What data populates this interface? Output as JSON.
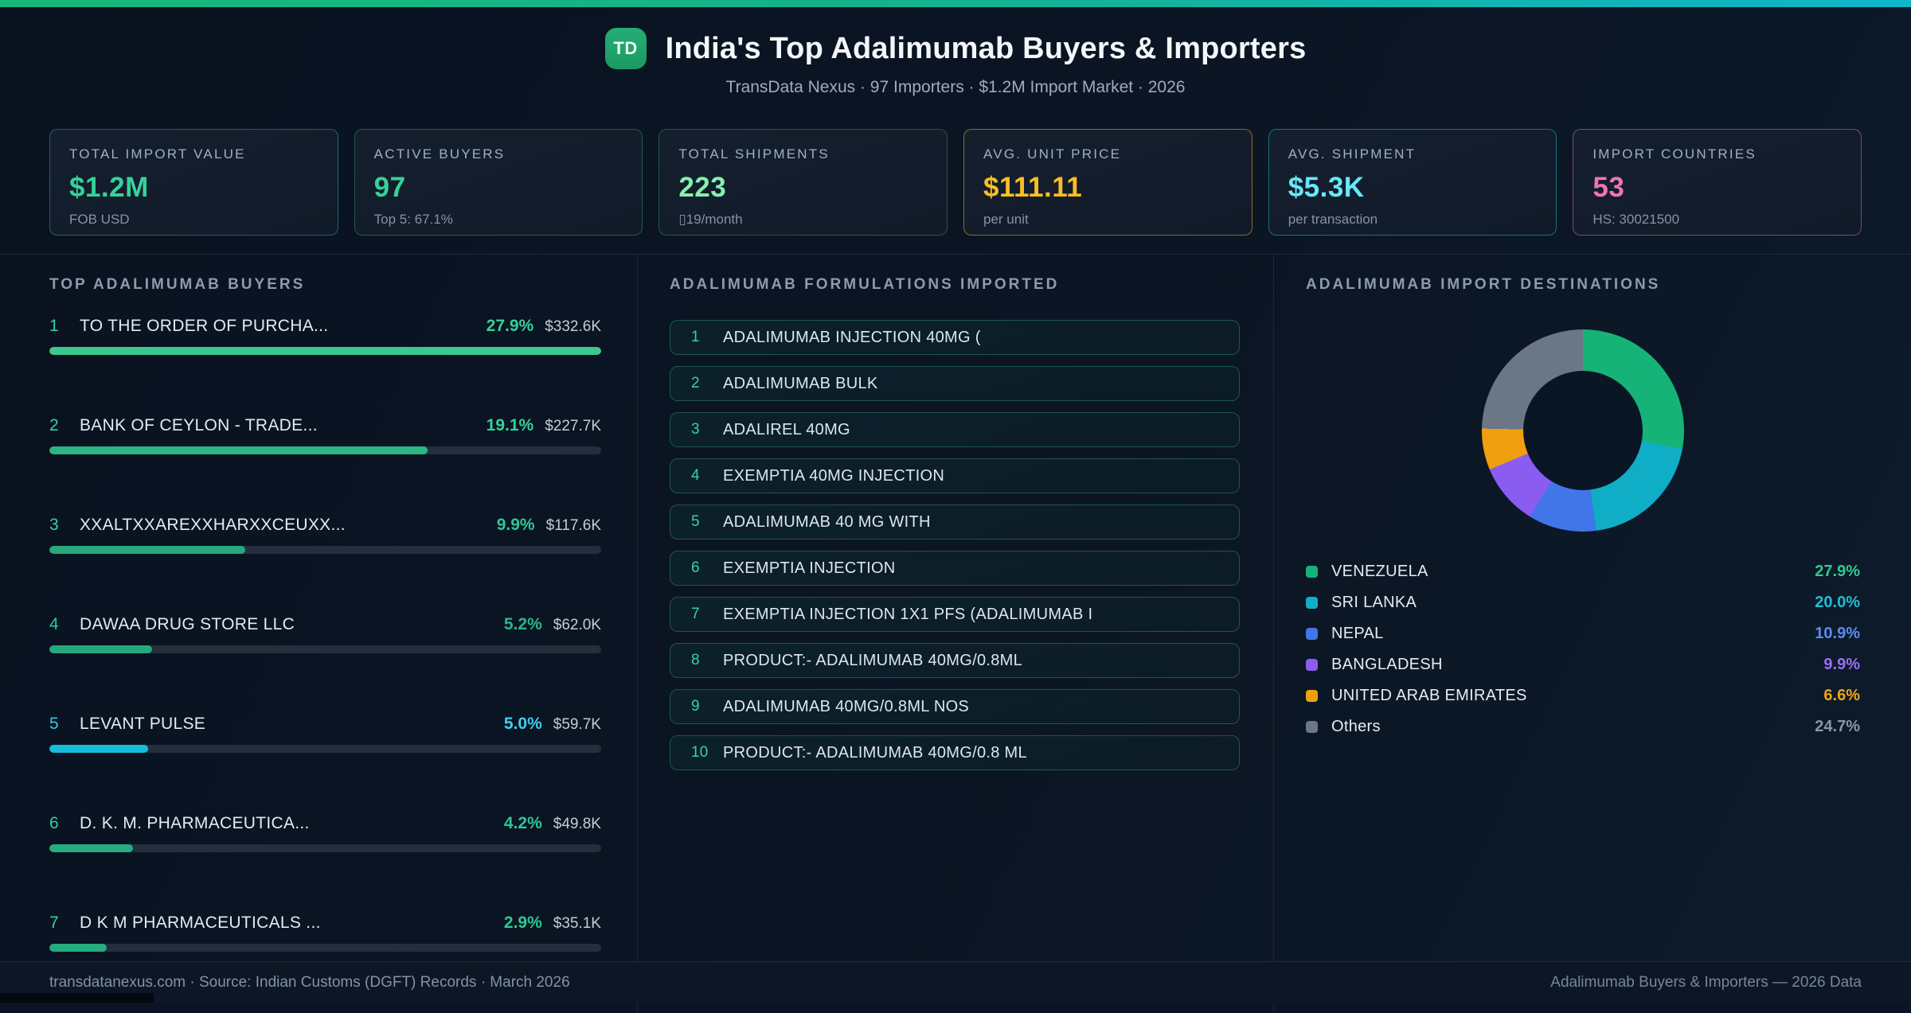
{
  "header": {
    "logo": "TD",
    "title": "India's Top Adalimumab Buyers & Importers",
    "subtitle": "TransData Nexus · 97 Importers · $1.2M Import Market · 2026"
  },
  "stats": [
    {
      "label": "TOTAL IMPORT VALUE",
      "value": "$1.2M",
      "sub": "FOB USD",
      "value_color": "#34d399",
      "border_color": "rgba(45,212,191,0.40)"
    },
    {
      "label": "ACTIVE BUYERS",
      "value": "97",
      "sub": "Top 5: 67.1%",
      "value_color": "#34d399",
      "border_color": "rgba(52,211,153,0.35)"
    },
    {
      "label": "TOTAL SHIPMENTS",
      "value": "223",
      "sub": "▯19/month",
      "value_color": "#86efac",
      "border_color": "rgba(74,222,128,0.30)"
    },
    {
      "label": "AVG. UNIT PRICE",
      "value": "$111.11",
      "sub": "per unit",
      "value_color": "#fbbf24",
      "border_color": "rgba(251,191,36,0.50)"
    },
    {
      "label": "AVG. SHIPMENT",
      "value": "$5.3K",
      "sub": "per transaction",
      "value_color": "#67e8f9",
      "border_color": "rgba(34,211,238,0.45)"
    },
    {
      "label": "IMPORT COUNTRIES",
      "value": "53",
      "sub": "HS: 30021500",
      "value_color": "#f472b6",
      "border_color": "rgba(244,114,182,0.50)"
    }
  ],
  "buyers": {
    "title": "TOP ADALIMUMAB BUYERS",
    "items": [
      {
        "rank": "1",
        "name": "TO THE ORDER OF PURCHA...",
        "pct": 27.9,
        "pct_label": "27.9%",
        "value": "$332.6K",
        "accent": "#3dc98d",
        "pct_color": "#34d399",
        "rank_color": "#2dd49f"
      },
      {
        "rank": "2",
        "name": "BANK OF CEYLON - TRADE...",
        "pct": 19.1,
        "pct_label": "19.1%",
        "value": "$227.7K",
        "accent": "#2bb583",
        "pct_color": "#34d399",
        "rank_color": "#2dd49f"
      },
      {
        "rank": "3",
        "name": "XXALTXXAREXXHARXXCEUXX...",
        "pct": 9.9,
        "pct_label": "9.9%",
        "value": "$117.6K",
        "accent": "#27a97c",
        "pct_color": "#2fc796",
        "rank_color": "#2dd49f"
      },
      {
        "rank": "4",
        "name": "DAWAA DRUG STORE LLC",
        "pct": 5.2,
        "pct_label": "5.2%",
        "value": "$62.0K",
        "accent": "#26a87d",
        "pct_color": "#2bb58a",
        "rank_color": "#2ac89a"
      },
      {
        "rank": "5",
        "name": "LEVANT PULSE",
        "pct": 5.0,
        "pct_label": "5.0%",
        "value": "$59.7K",
        "accent": "#17bdd8",
        "pct_color": "#41cdf0",
        "rank_color": "#36c5e6"
      },
      {
        "rank": "6",
        "name": "D. K. M. PHARMACEUTICA...",
        "pct": 4.2,
        "pct_label": "4.2%",
        "value": "$49.8K",
        "accent": "#25ad80",
        "pct_color": "#2fc796",
        "rank_color": "#2dd49f"
      },
      {
        "rank": "7",
        "name": "D K M PHARMACEUTICALS ...",
        "pct": 2.9,
        "pct_label": "2.9%",
        "value": "$35.1K",
        "accent": "#25ad80",
        "pct_color": "#2fc796",
        "rank_color": "#2dd49f"
      }
    ]
  },
  "formulations": {
    "title": "ADALIMUMAB FORMULATIONS IMPORTED",
    "items": [
      {
        "rank": "1",
        "name": "ADALIMUMAB INJECTION 40MG ("
      },
      {
        "rank": "2",
        "name": "ADALIMUMAB BULK"
      },
      {
        "rank": "3",
        "name": "ADALIREL 40MG"
      },
      {
        "rank": "4",
        "name": "EXEMPTIA 40MG INJECTION"
      },
      {
        "rank": "5",
        "name": "ADALIMUMAB 40 MG WITH"
      },
      {
        "rank": "6",
        "name": "EXEMPTIA INJECTION"
      },
      {
        "rank": "7",
        "name": "EXEMPTIA INJECTION 1X1 PFS (ADALIMUMAB I"
      },
      {
        "rank": "8",
        "name": "PRODUCT:- ADALIMUMAB 40MG/0.8ML"
      },
      {
        "rank": "9",
        "name": "ADALIMUMAB 40MG/0.8ML NOS"
      },
      {
        "rank": "10",
        "name": "PRODUCT:- ADALIMUMAB 40MG/0.8 ML"
      }
    ]
  },
  "destinations": {
    "title": "ADALIMUMAB IMPORT DESTINATIONS"
  },
  "chart_data": [
    {
      "type": "pie",
      "title": "ADALIMUMAB IMPORT DESTINATIONS",
      "labels": [
        "VENEZUELA",
        "SRI LANKA",
        "NEPAL",
        "BANGLADESH",
        "UNITED ARAB EMIRATES",
        "Others"
      ],
      "values": [
        27.9,
        20.0,
        10.9,
        9.9,
        6.6,
        24.7
      ],
      "value_labels": [
        "27.9%",
        "20.0%",
        "10.9%",
        "9.9%",
        "6.6%",
        "24.7%"
      ],
      "colors": [
        "#15b377",
        "#10aec6",
        "#4176e8",
        "#8b5cf0",
        "#f0a00e",
        "#6b7787"
      ],
      "legend_pct_colors": [
        "#2ecc8e",
        "#22bdd4",
        "#5d8cf2",
        "#9a6ef5",
        "#f0a513",
        "#8a97a8"
      ],
      "donut": true,
      "start_angle_deg": 0,
      "legend_position": "bottom"
    },
    {
      "type": "bar",
      "title": "TOP ADALIMUMAB BUYERS",
      "orientation": "horizontal",
      "categories": [
        "TO THE ORDER OF PURCHA...",
        "BANK OF CEYLON - TRADE...",
        "XXALTXXAREXXHARXXCEUXX...",
        "DAWAA DRUG STORE LLC",
        "LEVANT PULSE",
        "D. K. M. PHARMACEUTICA...",
        "D K M PHARMACEUTICALS ..."
      ],
      "values": [
        27.9,
        19.1,
        9.9,
        5.2,
        5.0,
        4.2,
        2.9
      ],
      "value_labels": [
        "$332.6K",
        "$227.7K",
        "$117.6K",
        "$62.0K",
        "$59.7K",
        "$49.8K",
        "$35.1K"
      ],
      "unit": "%",
      "xlim": [
        0,
        27.9
      ]
    }
  ],
  "footer": {
    "left": "transdatanexus.com · Source: Indian Customs (DGFT) Records · March 2026",
    "right": "Adalimumab Buyers & Importers — 2026 Data"
  }
}
